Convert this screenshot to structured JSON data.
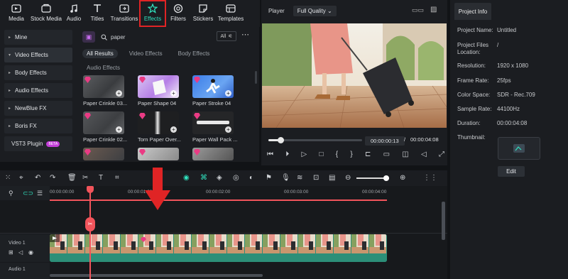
{
  "toolbar": {
    "items": [
      {
        "label": "Media",
        "icon": "media-icon"
      },
      {
        "label": "Stock Media",
        "icon": "stock-media-icon"
      },
      {
        "label": "Audio",
        "icon": "music-note-icon"
      },
      {
        "label": "Titles",
        "icon": "titles-icon"
      },
      {
        "label": "Transitions",
        "icon": "transitions-icon"
      },
      {
        "label": "Effects",
        "icon": "effects-icon"
      },
      {
        "label": "Filters",
        "icon": "filters-icon"
      },
      {
        "label": "Stickers",
        "icon": "stickers-icon"
      },
      {
        "label": "Templates",
        "icon": "templates-icon"
      }
    ],
    "selected": "Effects"
  },
  "sidebar": {
    "items": [
      {
        "label": "Mine",
        "arrow": "▸"
      },
      {
        "label": "Video Effects",
        "arrow": "▾"
      },
      {
        "label": "Body Effects",
        "arrow": "▸"
      },
      {
        "label": "Audio Effects",
        "arrow": "▸"
      },
      {
        "label": "NewBlue FX",
        "arrow": "▸"
      },
      {
        "label": "Boris FX",
        "arrow": "▸"
      },
      {
        "label": "VST3 Plugin",
        "arrow": "",
        "badge": "BETA"
      }
    ]
  },
  "library": {
    "search_value": "paper",
    "filter": "All",
    "more": "⋯",
    "categories": [
      "All Results",
      "Video Effects",
      "Body Effects",
      "Audio Effects"
    ],
    "effects": [
      {
        "label": "Paper Crinkle 03..."
      },
      {
        "label": "Paper Shape 04"
      },
      {
        "label": "Paper Stroke 04"
      },
      {
        "label": "Paper Crinkle 02..."
      },
      {
        "label": "Torn Paper Over..."
      },
      {
        "label": "Paper Wall Pack ..."
      }
    ]
  },
  "player": {
    "title": "Player",
    "quality": "Full Quality",
    "current_time": "00:00:00:13",
    "separator": "/",
    "total_time": "00:00:04:08",
    "progress_fraction": 0.13
  },
  "project_info": {
    "tab": "Project Info",
    "rows": [
      {
        "label": "Project Name:",
        "value": "Untitled"
      },
      {
        "label": "Project Files Location:",
        "value": "/"
      },
      {
        "label": "Resolution:",
        "value": "1920 x 1080"
      },
      {
        "label": "Frame Rate:",
        "value": "25fps"
      },
      {
        "label": "Color Space:",
        "value": "SDR - Rec.709"
      },
      {
        "label": "Sample Rate:",
        "value": "44100Hz"
      },
      {
        "label": "Duration:",
        "value": "00:00:04:08"
      },
      {
        "label": "Thumbnail:",
        "value": ""
      }
    ],
    "edit_label": "Edit"
  },
  "timeline": {
    "ruler": [
      "00:00:00:00",
      "00:00:01:00",
      "00:00:02:00",
      "00:00:03:00",
      "00:00:04:00"
    ],
    "tracks": [
      {
        "label": "Video 1"
      },
      {
        "label": "Audio 1"
      }
    ]
  },
  "colors": {
    "accent": "#31e4c0",
    "highlight_box": "#e02425",
    "playhead": "#f2545b",
    "premium_gem": "#ea3b84"
  }
}
